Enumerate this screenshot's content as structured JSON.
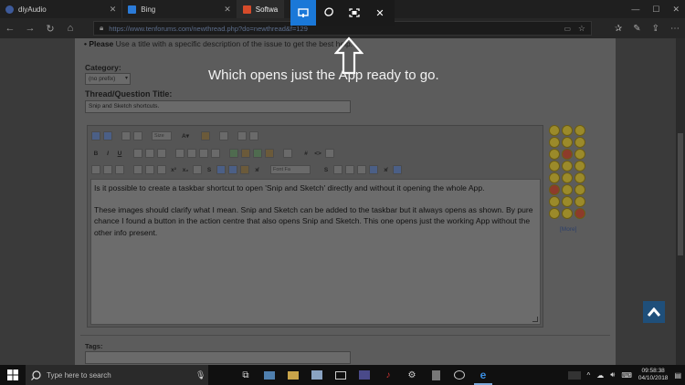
{
  "browser": {
    "tabs": [
      {
        "label": "diyAudio",
        "active": false,
        "color": "#3d5a9a"
      },
      {
        "label": "Bing",
        "active": false,
        "color": "#2b7bd8"
      },
      {
        "label": "Softwa",
        "active": true,
        "color": "#d64b2a"
      }
    ],
    "url": "https://www.tenforums.com/newthread.php?do=newthread&f=129"
  },
  "snip_toolbar": {
    "tools": [
      "rectangular-snip",
      "freeform-snip",
      "fullscreen-snip",
      "close"
    ],
    "active_tool": "rectangular-snip"
  },
  "page": {
    "please_prefix": "• Please",
    "please_text": "Use a title with a specific description of the issue to get the best help.",
    "category_label": "Category:",
    "category_value": "(no prefix)",
    "title_label": "Thread/Question Title:",
    "title_value": "Snip and Sketch shortcuts.",
    "editor": {
      "font_size_dropdown": "Size",
      "font_dropdown": "Font Fa",
      "body_paragraph_1": "Is it possible to create a taskbar shortcut to open 'Snip and Sketch' directly and without it opening the whole App.",
      "body_paragraph_2": "These images should clarify what I mean. Snip and Sketch can be added to the taskbar but it always opens as shown. By pure chance I found a button in the action centre that also opens Snip and Sketch. This one opens just the working App without the other info present."
    },
    "more_smilies": "[More]",
    "tags_label": "Tags:"
  },
  "overlay": {
    "caption": "Which opens just the App ready to go."
  },
  "taskbar": {
    "search_placeholder": "Type here to search",
    "time": "09:58:38",
    "date": "04/10/2018"
  },
  "colors": {
    "snip_active": "#1a78d8",
    "page_dim": "#5c5c5c",
    "taskbar": "#101010"
  }
}
